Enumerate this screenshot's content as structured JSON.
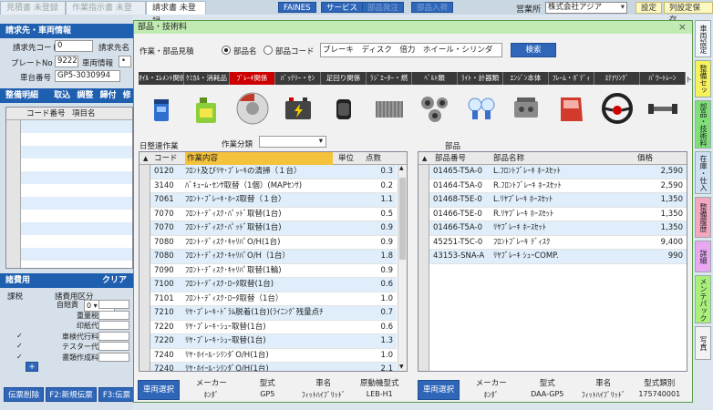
{
  "top": {
    "tabs": [
      "見積書 未登録",
      "作業指示書 未登録",
      "請求書 未登録"
    ],
    "buttons": [
      "FAINES",
      "サービス",
      "部品発注",
      "部品入荷"
    ],
    "office_label": "営業所",
    "office_value": "株式会社アジア",
    "settings": "設定",
    "column_settings": "列設定保存"
  },
  "left": {
    "billing_header": "請求先・車両情報",
    "billing_code_label": "請求先コード",
    "billing_code_value": "0",
    "billing_name_label": "請求先名",
    "plate_label": "プレートNo",
    "plate_value": "9222",
    "vehicle_info_label": "車両情報",
    "vehicle_info_value": "•",
    "chassis_label": "車台番号",
    "chassis_value": "GP5-3030994",
    "maint_header": "整備明細",
    "maint_actions": [
      "取込",
      "調整",
      "歸付",
      "修"
    ],
    "grid_cols": [
      "コード番号",
      "項目名"
    ],
    "expense_header": "諸費用",
    "expense_clear": "クリア",
    "expense_col1": "課税",
    "expense_col2": "諸費用区分",
    "expense_rows": [
      {
        "check": "",
        "label": "自賠責",
        "extra": "0 ▾ヶ月"
      },
      {
        "check": "",
        "label": "重量税",
        "extra": ""
      },
      {
        "check": "",
        "label": "印紙代",
        "extra": ""
      },
      {
        "check": "✓",
        "label": "車検代行料",
        "extra": ""
      },
      {
        "check": "✓",
        "label": "テスター代",
        "extra": ""
      },
      {
        "check": "✓",
        "label": "書類作成料",
        "extra": ""
      }
    ],
    "add_btn": "+",
    "footer_buttons": [
      "伝票削除",
      "F2:新規伝票",
      "F3:伝票"
    ]
  },
  "dialog": {
    "title": "部品・技術料",
    "close": "×",
    "search_section": "作業・部品見積",
    "radio_name": "部品名",
    "radio_code": "部品コード",
    "search_value": "ブレーキ　ディスク　倍力　ホイール・シリンダ",
    "search_btn": "検索",
    "categories": [
      "ｵｲﾙ・ｴﾚﾒﾝﾄ関係",
      "ｹﾐｶﾙ・消耗品",
      "ﾌﾞﾚｰｷ関係",
      "ﾊﾞｯﾃﾘｰ・ｾﾝ",
      "足回り関係",
      "ﾗｼﾞｴｰﾀｰ・燃",
      "ﾍﾞﾙﾄ類",
      "ﾗｲﾄ・計器類",
      "ｴﾝｼﾞﾝ本体",
      "ﾌﾚｰﾑ・ﾎﾞﾃﾞｨ",
      "ｽﾃｱﾘﾝｸﾞ",
      "ﾊﾟﾜｰﾄﾚｰﾝ"
    ],
    "category_icons": [
      "oil-filter-icon",
      "chemical-can-icon",
      "brake-disc-icon",
      "battery-icon",
      "suspension-icon",
      "radiator-icon",
      "belt-icon",
      "bulb-icon",
      "engine-icon",
      "car-door-icon",
      "steering-wheel-icon",
      "drive-shaft-icon"
    ],
    "work_title": "日整連作業",
    "work_class_label": "作業分類",
    "work_cols": [
      "コード",
      "作業内容",
      "単位",
      "点数"
    ],
    "work_rows": [
      [
        "0120",
        "ﾌﾛﾝﾄ及びﾘﾔ･ﾌﾞﾚｰｷの清掃（１台）",
        "",
        "0.3"
      ],
      [
        "3140",
        "ﾊﾞｷｭｰﾑ･ｾﾝｻ取替（1個）(MAPｾﾝｻ)",
        "",
        "0.2"
      ],
      [
        "7061",
        "ﾌﾛﾝﾄ･ﾌﾞﾚｰｷ･ﾎｰｽ取替（１台）",
        "",
        "1.1"
      ],
      [
        "7070",
        "ﾌﾛﾝﾄ･ﾃﾞｨｽｸ･ﾊﾟｯﾄﾞ取替(1台)",
        "",
        "0.5"
      ],
      [
        "7070",
        "ﾌﾛﾝﾄ･ﾃﾞｨｽｸ･ﾊﾟｯﾄﾞ取替(1台)",
        "",
        "0.9"
      ],
      [
        "7080",
        "ﾌﾛﾝﾄ･ﾃﾞｨｽｸ･ｷｬﾘﾊﾟO/H(1台)",
        "",
        "0.9"
      ],
      [
        "7080",
        "ﾌﾛﾝﾄ･ﾃﾞｨｽｸ･ｷｬﾘﾊﾟO/H（1台）",
        "",
        "1.8"
      ],
      [
        "7090",
        "ﾌﾛﾝﾄ･ﾃﾞｨｽｸ･ｷｬﾘﾊﾟ取替(1輪)",
        "",
        "0.9"
      ],
      [
        "7100",
        "ﾌﾛﾝﾄ･ﾃﾞｨｽｸ･ﾛｰﾀ取替(1台)",
        "",
        "0.6"
      ],
      [
        "7101",
        "ﾌﾛﾝﾄ･ﾃﾞｨｽｸ･ﾛｰﾀ取替（1台）",
        "",
        "1.0"
      ],
      [
        "7210",
        "ﾘﾔ･ﾌﾞﾚｰｷ･ﾄﾞﾗﾑ脱着(1台)(ﾗｲﾆﾝｸﾞ残量点ﾁ",
        "",
        "0.7"
      ],
      [
        "7220",
        "ﾘﾔ･ﾌﾞﾚｰｷ･ｼｭｰ取替(1台)",
        "",
        "0.6"
      ],
      [
        "7220",
        "ﾘﾔ･ﾌﾞﾚｰｷ･ｼｭｰ取替(1台)",
        "",
        "1.3"
      ],
      [
        "7240",
        "ﾘﾔ･ﾎｲｰﾙ･ｼﾘﾝﾀﾞO/H(1台)",
        "",
        "1.0"
      ],
      [
        "7240",
        "ﾘﾔ･ﾎｲｰﾙ･ｼﾘﾝﾀﾞO/H(1台)",
        "",
        "2.1"
      ]
    ],
    "parts_title": "部品",
    "parts_cols": [
      "部品番号",
      "部品名称",
      "価格"
    ],
    "parts_rows": [
      [
        "01465-T5A-0",
        "L.ﾌﾛﾝﾄﾌﾞﾚｰｷ ﾎｰｽｾｯﾄ",
        "2,590"
      ],
      [
        "01464-T5A-0",
        "R.ﾌﾛﾝﾄﾌﾞﾚｰｷ ﾎｰｽｾｯﾄ",
        "2,590"
      ],
      [
        "01468-T5E-0",
        "L.ﾘﾔﾌﾞﾚｰｷ ﾎｰｽｾｯﾄ",
        "1,350"
      ],
      [
        "01466-T5E-0",
        "R.ﾘﾔﾌﾞﾚｰｷ ﾎｰｽｾｯﾄ",
        "1,350"
      ],
      [
        "01466-T5A-0",
        "ﾘﾔﾌﾞﾚｰｷ ﾎｰｽｾｯﾄ",
        "1,350"
      ],
      [
        "45251-T5C-0",
        "ﾌﾛﾝﾄﾌﾞﾚｰｷ ﾃﾞｨｽｸ",
        "9,400"
      ],
      [
        "43153-SNA-A",
        "ﾘﾔﾌﾞﾚｰｷ ｼｭｰCOMP.",
        "990"
      ]
    ],
    "vehicle_btn": "車両選択",
    "vehicle_cols_left": [
      "メーカー",
      "型式",
      "車名",
      "原動機型式"
    ],
    "vehicle_vals_left": [
      "ﾎﾝﾀﾞ",
      "GP5",
      "ﾌｨｯﾄﾊｲﾌﾞﾘｯﾄﾞ",
      "LEB-H1"
    ],
    "vehicle_cols_right": [
      "メーカー",
      "型式",
      "車名",
      "型式類別"
    ],
    "vehicle_vals_right": [
      "ﾎﾝﾀﾞ",
      "DAA-GP5",
      "ﾌｨｯﾄﾊｲﾌﾞﾘｯﾄﾞ",
      "175740001"
    ]
  },
  "right_tabs": [
    "車両設定",
    "整備セット",
    "部品・技術料",
    "在庫・仕入",
    "整備履歴",
    "詳細",
    "メンテパック",
    "写真"
  ],
  "right_tab_colors": [
    "#f2f6fa",
    "#f7f25a",
    "#7fe07a",
    "#cfe0f2",
    "#f4a7c0",
    "#e8a8f2",
    "#a8f07a",
    "#f2f2f2"
  ]
}
